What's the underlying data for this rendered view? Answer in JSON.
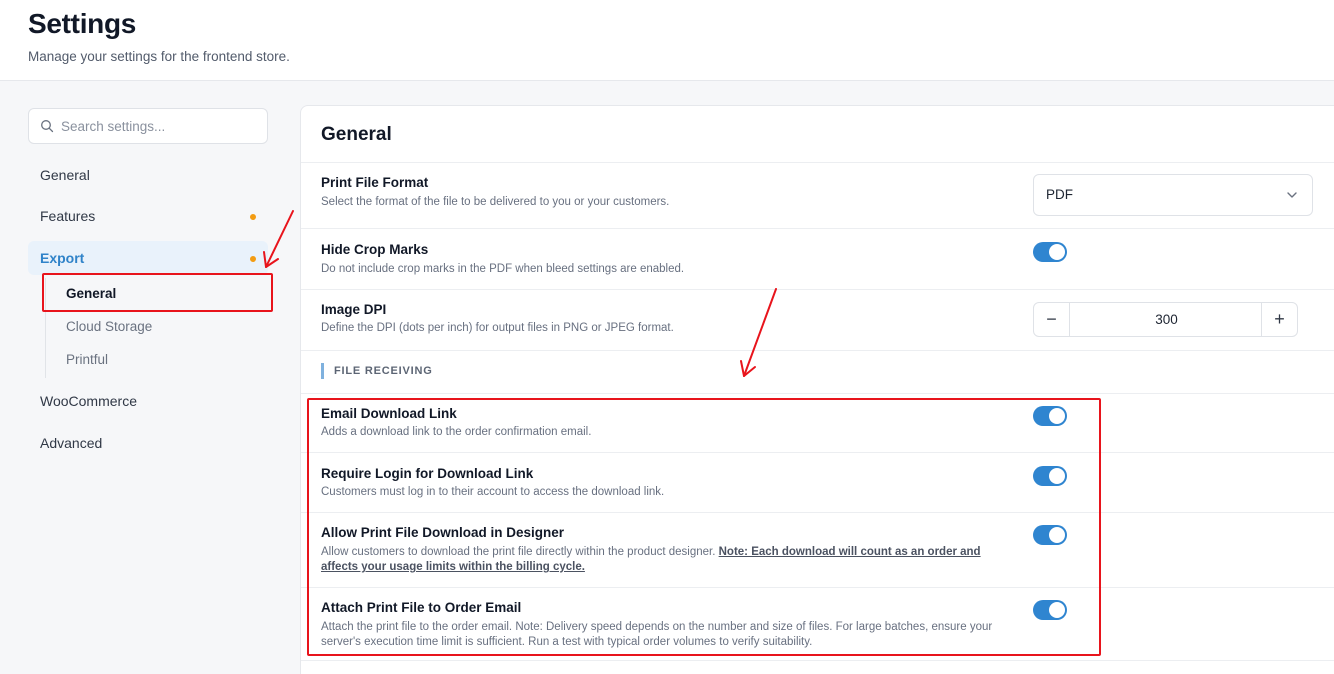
{
  "header": {
    "title": "Settings",
    "subtitle": "Manage your settings for the frontend store."
  },
  "search": {
    "placeholder": "Search settings..."
  },
  "sidebar": {
    "items": [
      {
        "label": "General",
        "dot": false
      },
      {
        "label": "Features",
        "dot": true
      },
      {
        "label": "Export",
        "dot": true,
        "active": true
      },
      {
        "label": "WooCommerce",
        "dot": false
      },
      {
        "label": "Advanced",
        "dot": false
      }
    ],
    "export_subitems": [
      {
        "label": "General",
        "active": true
      },
      {
        "label": "Cloud Storage"
      },
      {
        "label": "Printful"
      }
    ]
  },
  "panel": {
    "title": "General",
    "print_format": {
      "title": "Print File Format",
      "description": "Select the format of the file to be delivered to you or your customers.",
      "value": "PDF"
    },
    "hide_crop_marks": {
      "title": "Hide Crop Marks",
      "description": "Do not include crop marks in the PDF when bleed settings are enabled.",
      "enabled": true
    },
    "image_dpi": {
      "title": "Image DPI",
      "description": "Define the DPI (dots per inch) for output files in PNG or JPEG format.",
      "value": "300",
      "minus": "−",
      "plus": "+"
    },
    "file_receiving": {
      "section_label": "FILE RECEIVING",
      "email_download_link": {
        "title": "Email Download Link",
        "description": "Adds a download link to the order confirmation email.",
        "enabled": true
      },
      "require_login": {
        "title": "Require Login for Download Link",
        "description": "Customers must log in to their account to access the download link.",
        "enabled": true
      },
      "allow_designer_download": {
        "title": "Allow Print File Download in Designer",
        "description": "Allow customers to download the print file directly within the product designer.",
        "note": "Note: Each download will count as an order and affects your usage limits within the billing cycle.",
        "enabled": true
      },
      "attach_print_file": {
        "title": "Attach Print File to Order Email",
        "description": "Attach the print file to the order email. Note: Delivery speed depends on the number and size of files. For large batches, ensure your server's execution time limit is sufficient. Run a test with typical order volumes to verify suitability.",
        "enabled": true
      }
    }
  },
  "colors": {
    "accent": "#2f85d0",
    "active_nav_bg": "#e9f2fb",
    "dot": "#f39c12",
    "annotation": "#e8141c"
  }
}
